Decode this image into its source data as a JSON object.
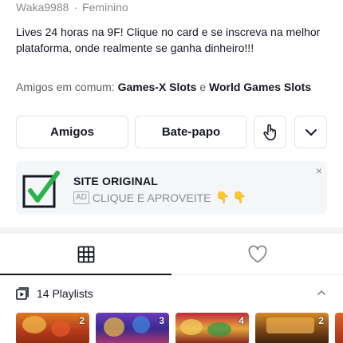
{
  "profile": {
    "username": "Waka9988",
    "separator": "·",
    "gender": "Feminino",
    "bio": "Lives 24 horas na 9F! Clique no card e se inscreva na melhor plataforma, onde realmente se ganha dinheiro!!!",
    "mutual_prefix": "Amigos em comum:",
    "mutual_friend_1": "Games-X Slots",
    "mutual_connector": "e",
    "mutual_friend_2": "World Games Slots"
  },
  "actions": {
    "friends_label": "Amigos",
    "chat_label": "Bate-papo",
    "hand_icon": "hand-pointer-icon",
    "more_icon": "chevron-down-icon"
  },
  "ad": {
    "title": "SITE ORIGINAL",
    "tag": "AD",
    "text": "CLIQUE E APROVEITE",
    "emoji": "👇 👇",
    "close": "×",
    "logo_color": "#2bb24c"
  },
  "tabs": [
    {
      "icon": "grid-icon",
      "selected": true
    },
    {
      "icon": "heart-outline-icon",
      "selected": false
    }
  ],
  "playlists": {
    "label": "14 Playlists",
    "icon": "playlist-icon",
    "chevron": "chevron-up-icon"
  },
  "thumbnails": [
    {
      "count": "2"
    },
    {
      "count": "3"
    },
    {
      "count": "4"
    },
    {
      "count": "2"
    }
  ]
}
